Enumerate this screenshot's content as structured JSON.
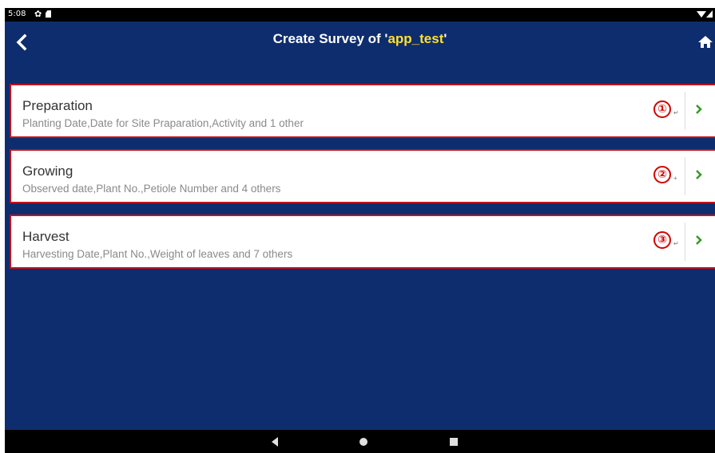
{
  "status_bar": {
    "time": "5:08",
    "icons": [
      "gear-icon",
      "sd-card-icon",
      "wifi-icon",
      "signal-icon",
      "battery-icon"
    ]
  },
  "header": {
    "title_prefix": "Create Survey of '",
    "app_name": "app_test",
    "title_suffix": "'",
    "back_icon": "chevron-left-icon",
    "home_icon": "home-icon"
  },
  "surveys": [
    {
      "title": "Preparation",
      "subtitle": "Planting Date,Date for Site Praparation,Activity and 1 other",
      "badge": "①"
    },
    {
      "title": "Growing",
      "subtitle": "Observed date,Plant No.,Petiole Number and 4 others",
      "badge": "②"
    },
    {
      "title": "Harvest",
      "subtitle": "Harvesting Date,Plant No.,Weight of leaves and 7 others",
      "badge": "③"
    }
  ],
  "colors": {
    "app_background": "#0e2d6e",
    "title_highlight": "#ffe12b",
    "card_border": "#c1121c",
    "chevron": "#3a9a2a",
    "badge": "#d40000"
  },
  "nav_bar": {
    "icons": [
      "back-triangle-icon",
      "home-circle-icon",
      "recents-square-icon"
    ]
  }
}
